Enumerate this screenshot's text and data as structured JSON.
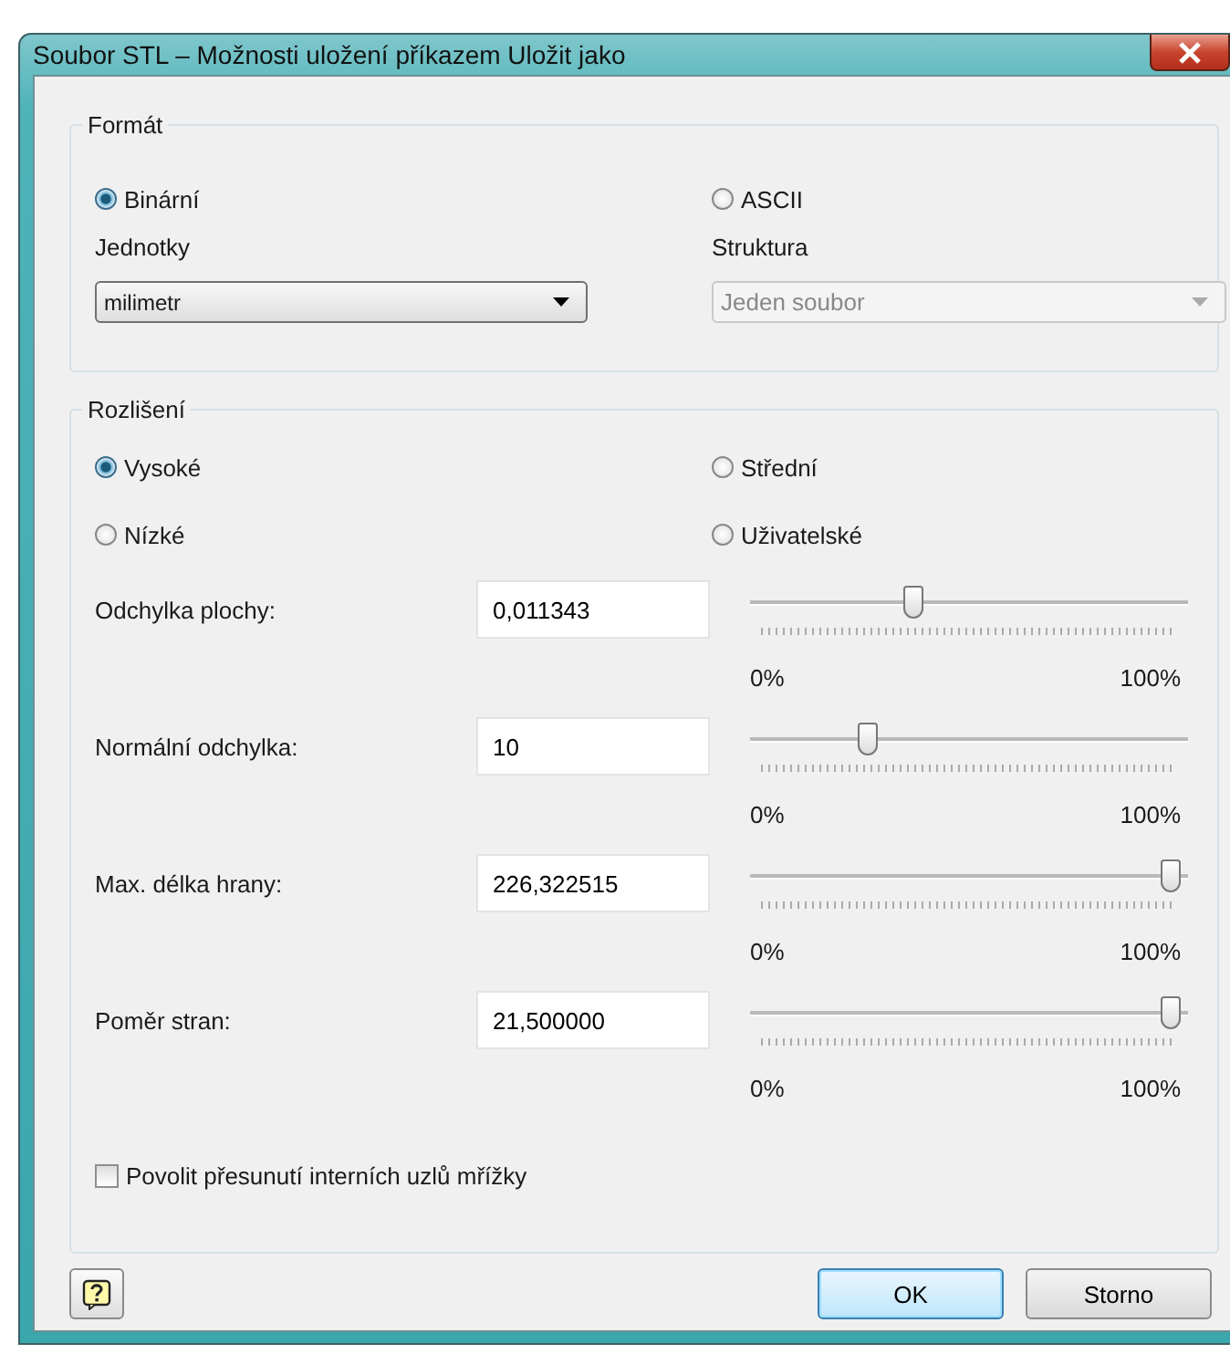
{
  "window": {
    "title": "Soubor STL – Možnosti uložení příkazem Uložit jako"
  },
  "format": {
    "label": "Formát",
    "options": [
      {
        "label": "Binární",
        "selected": true
      },
      {
        "label": "ASCII",
        "selected": false
      }
    ],
    "fields": [
      {
        "label": "Jednotky",
        "value": "milimetr",
        "disabled": false
      },
      {
        "label": "Struktura",
        "value": "Jeden soubor",
        "disabled": true
      }
    ]
  },
  "resolution": {
    "label": "Rozlišení",
    "options": [
      {
        "label": "Vysoké",
        "selected": true
      },
      {
        "label": "Střední",
        "selected": false
      },
      {
        "label": "Nízké",
        "selected": false
      },
      {
        "label": "Uživatelské",
        "selected": false
      }
    ],
    "params": [
      {
        "label": "Odchylka plochy:",
        "value": "0,011343",
        "level": 0.36,
        "min_label": "0%",
        "max_label": "100%"
      },
      {
        "label": "Normální odchylka:",
        "value": "10",
        "level": 0.25,
        "min_label": "0%",
        "max_label": "100%"
      },
      {
        "label": "Max. délka hrany:",
        "value": "226,322515",
        "level": 1,
        "min_label": "0%",
        "max_label": "100%"
      },
      {
        "label": "Poměr stran:",
        "value": "21,500000",
        "level": 1,
        "min_label": "0%",
        "max_label": "100%"
      }
    ]
  },
  "checkbox": {
    "label": "Povolit přesunutí interních uzlů mřížky",
    "checked": false
  },
  "buttons": [
    {
      "label": "OK",
      "default": true
    },
    {
      "label": "Storno",
      "default": false
    }
  ]
}
